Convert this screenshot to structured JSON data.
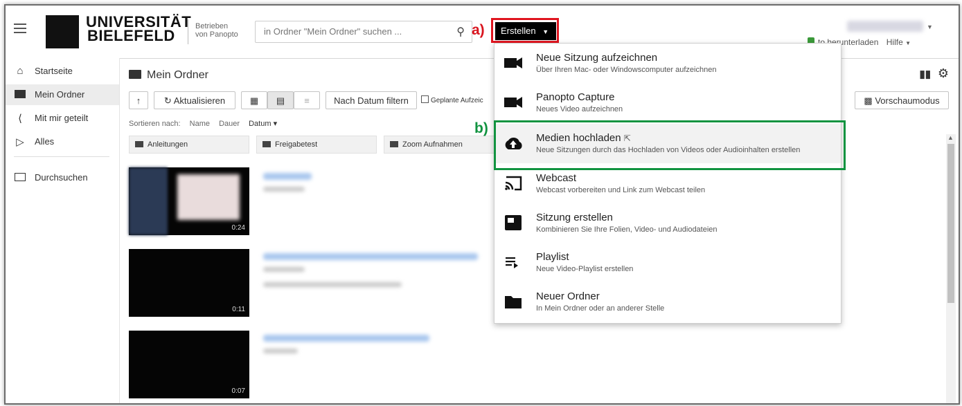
{
  "header": {
    "logo_line1": "UNIVERSITÄT",
    "logo_line2": "BIELEFELD",
    "byline_1": "Betrieben",
    "byline_2": "von Panopto",
    "search_placeholder": "in Ordner \"Mein Ordner\" suchen ...",
    "create_label": "Erstellen",
    "download_label": "to herunterladen",
    "help_label": "Hilfe"
  },
  "annotations": {
    "a": "a)",
    "b": "b)"
  },
  "sidebar": {
    "items": [
      {
        "label": "Startseite",
        "icon": "home-icon"
      },
      {
        "label": "Mein Ordner",
        "icon": "folder-user-icon"
      },
      {
        "label": "Mit mir geteilt",
        "icon": "share-icon"
      },
      {
        "label": "Alles",
        "icon": "play-library-icon"
      },
      {
        "label": "Durchsuchen",
        "icon": "folder-outline-icon"
      }
    ],
    "active_index": 1
  },
  "main": {
    "title": "Mein Ordner",
    "refresh_label": "Aktualisieren",
    "date_filter_label": "Nach Datum filtern",
    "scheduled_label": "Geplante Aufzeic",
    "preview_label": "Vorschaumodus",
    "sort": {
      "label": "Sortieren nach:",
      "name": "Name",
      "duration": "Dauer",
      "date": "Datum ▾"
    },
    "folders": [
      "Anleitungen",
      "Freigabetest",
      "Zoom Aufnahmen"
    ],
    "videos": [
      {
        "duration": "0:24"
      },
      {
        "duration": "0:11"
      },
      {
        "duration": "0:07"
      }
    ]
  },
  "create_menu": {
    "items": [
      {
        "title": "Neue Sitzung aufzeichnen",
        "subtitle": "Über Ihren Mac- oder Windowscomputer aufzeichnen",
        "icon": "video-camera-icon"
      },
      {
        "title": "Panopto Capture",
        "subtitle": "Neues Video aufzeichnen",
        "icon": "video-camera-icon"
      },
      {
        "title": "Medien hochladen",
        "subtitle": "Neue Sitzungen durch das Hochladen von Videos oder Audioinhalten erstellen",
        "icon": "cloud-upload-icon"
      },
      {
        "title": "Webcast",
        "subtitle": "Webcast vorbereiten und Link zum Webcast teilen",
        "icon": "cast-icon"
      },
      {
        "title": "Sitzung erstellen",
        "subtitle": "Kombinieren Sie Ihre Folien, Video- und Audiodateien",
        "icon": "session-icon"
      },
      {
        "title": "Playlist",
        "subtitle": "Neue Video-Playlist erstellen",
        "icon": "playlist-icon"
      },
      {
        "title": "Neuer Ordner",
        "subtitle": "In Mein Ordner oder an anderer Stelle",
        "icon": "folder-icon"
      }
    ],
    "highlighted_index": 2
  },
  "colors": {
    "annotation_red": "#e0151f",
    "annotation_green": "#119340",
    "brand": "#111111"
  }
}
